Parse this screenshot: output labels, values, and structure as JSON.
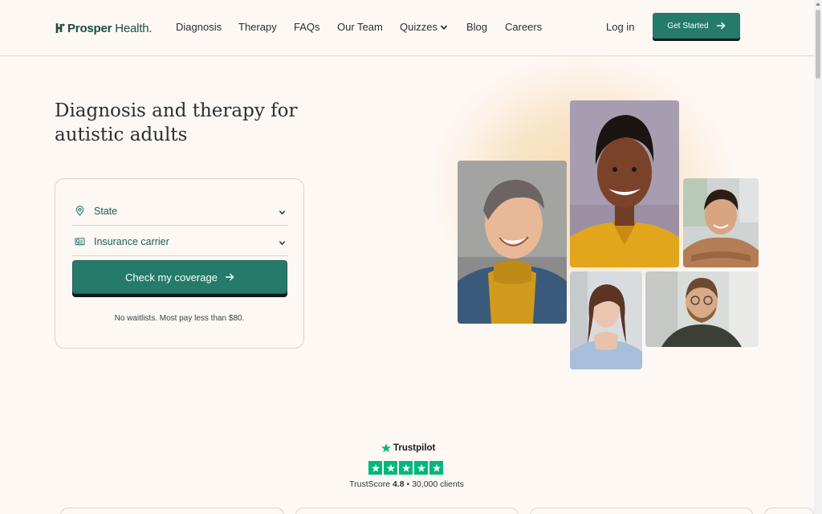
{
  "header": {
    "logo": {
      "bold": "Prosper",
      "regular": " Health."
    },
    "nav": [
      {
        "label": "Diagnosis"
      },
      {
        "label": "Therapy"
      },
      {
        "label": "FAQs"
      },
      {
        "label": "Our Team"
      },
      {
        "label": "Quizzes",
        "icon": "chevron-down-icon"
      },
      {
        "label": "Blog"
      },
      {
        "label": "Careers"
      }
    ],
    "login_label": "Log in",
    "cta_label": "Get Started"
  },
  "hero": {
    "title_line1": "Diagnosis and therapy for",
    "title_line2": "autistic adults"
  },
  "coverage_form": {
    "state_label": "State",
    "state_icon": "map-pin-icon",
    "insurance_label": "Insurance carrier",
    "insurance_icon": "id-card-icon",
    "submit_label": "Check my coverage",
    "note": "No waitlists. Most pay less than $80."
  },
  "trustpilot": {
    "brand": "Trustpilot",
    "score_label": "TrustScore",
    "score": "4.8",
    "separator": "•",
    "clients": "30,000 clients",
    "stars": 5
  },
  "colors": {
    "brand_green": "#247b69",
    "background": "#fdf8f4",
    "trustpilot_green": "#00b67a"
  }
}
